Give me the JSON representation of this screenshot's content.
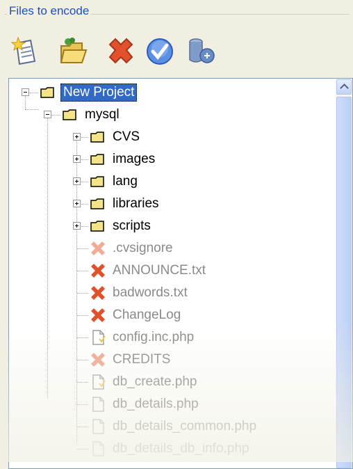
{
  "groupbox": {
    "title": "Files to encode"
  },
  "toolbar": {
    "buttons": [
      {
        "name": "new-project-icon"
      },
      {
        "name": "open-folder-icon"
      },
      {
        "name": "remove-icon"
      },
      {
        "name": "check-icon"
      },
      {
        "name": "database-icon"
      }
    ]
  },
  "tree": {
    "root": "New Project",
    "folder": "mysql",
    "subfolders": [
      "CVS",
      "images",
      "lang",
      "libraries",
      "scripts"
    ],
    "files": [
      ".cvsignore",
      "ANNOUNCE.txt",
      "badwords.txt",
      "ChangeLog",
      "config.inc.php",
      "CREDITS",
      "db_create.php",
      "db_details.php",
      "db_details_common.php",
      "db_details_db_info.php"
    ]
  },
  "colors": {
    "selection": "#316ac5",
    "title": "#1b4fc4",
    "folder": "#f3e48a",
    "excluded": "#e0512c"
  }
}
